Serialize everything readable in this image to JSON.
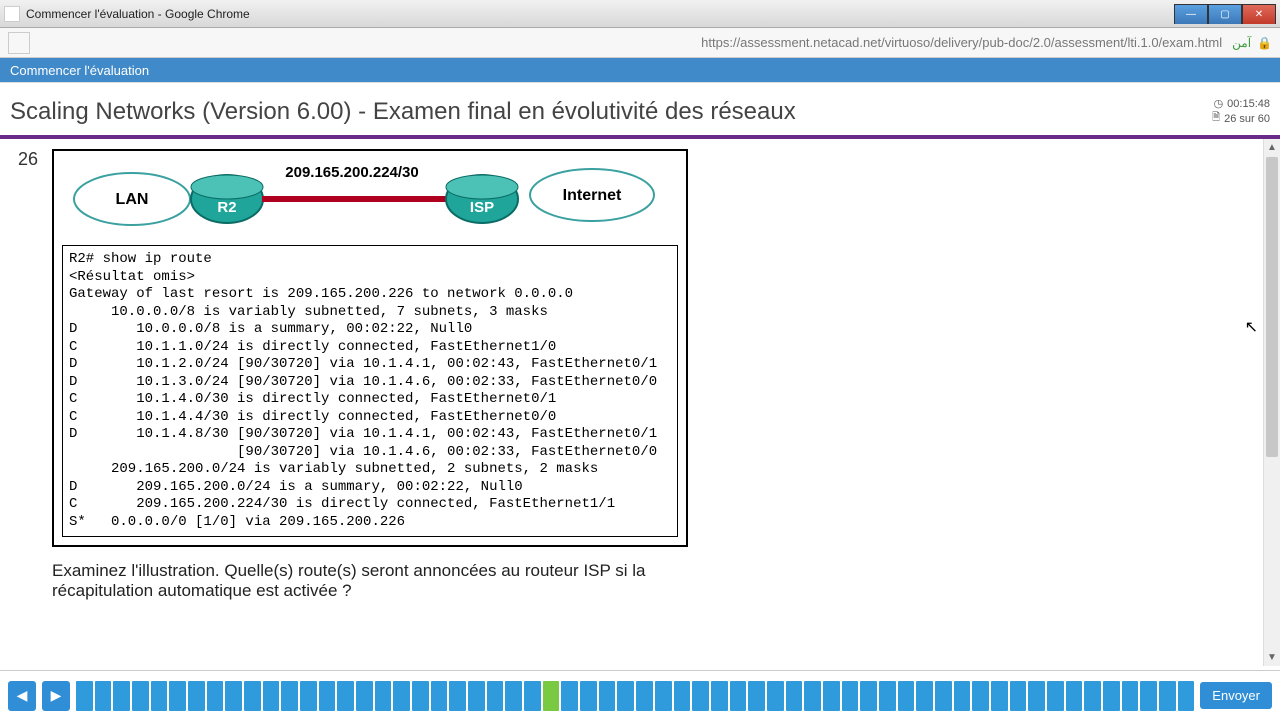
{
  "window": {
    "title": "Commencer l'évaluation - Google Chrome",
    "url": "https://assessment.netacad.net/virtuoso/delivery/pub-doc/2.0/assessment/lti.1.0/exam.html",
    "secure_label": "آمن"
  },
  "tab": {
    "label": "Commencer l'évaluation"
  },
  "exam": {
    "title": "Scaling Networks (Version 6.00) - Examen final en évolutivité des réseaux",
    "timer": "00:15:48",
    "progress": "26 sur 60"
  },
  "question": {
    "number": "26",
    "diagram": {
      "lan": "LAN",
      "r2": "R2",
      "link": "209.165.200.224/30",
      "isp": "ISP",
      "internet": "Internet"
    },
    "cli_text": "R2# show ip route\n<Résultat omis>\nGateway of last resort is 209.165.200.226 to network 0.0.0.0\n     10.0.0.0/8 is variably subnetted, 7 subnets, 3 masks\nD       10.0.0.0/8 is a summary, 00:02:22, Null0\nC       10.1.1.0/24 is directly connected, FastEthernet1/0\nD       10.1.2.0/24 [90/30720] via 10.1.4.1, 00:02:43, FastEthernet0/1\nD       10.1.3.0/24 [90/30720] via 10.1.4.6, 00:02:33, FastEthernet0/0\nC       10.1.4.0/30 is directly connected, FastEthernet0/1\nC       10.1.4.4/30 is directly connected, FastEthernet0/0\nD       10.1.4.8/30 [90/30720] via 10.1.4.1, 00:02:43, FastEthernet0/1\n                    [90/30720] via 10.1.4.6, 00:02:33, FastEthernet0/0\n     209.165.200.0/24 is variably subnetted, 2 subnets, 2 masks\nD       209.165.200.0/24 is a summary, 00:02:22, Null0\nC       209.165.200.224/30 is directly connected, FastEthernet1/1\nS*   0.0.0.0/0 [1/0] via 209.165.200.226",
    "text": "Examinez l'illustration. Quelle(s) route(s) seront annoncées au routeur ISP si la récapitulation automatique est activée ?"
  },
  "nav": {
    "total_cells": 60,
    "current_index": 26,
    "submit_label": "Envoyer"
  }
}
